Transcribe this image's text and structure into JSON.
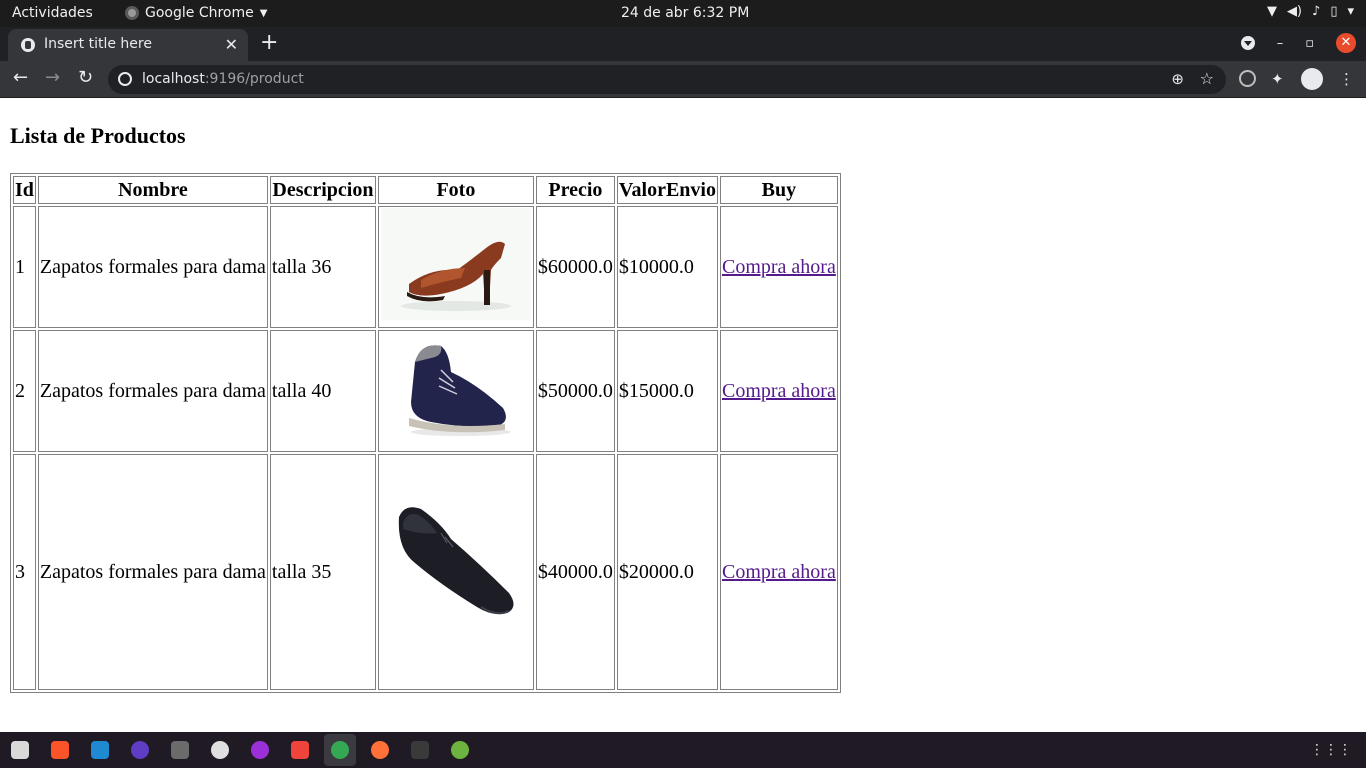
{
  "topbar": {
    "activities": "Actividades",
    "app_name": "Google Chrome",
    "clock": "24 de abr   6:32 PM"
  },
  "browser": {
    "tab_title": "Insert title here",
    "url_host": "localhost",
    "url_rest": ":9196/product"
  },
  "page": {
    "heading": "Lista de Productos",
    "columns": [
      "Id",
      "Nombre",
      "Descripcion",
      "Foto",
      "Precio",
      "ValorEnvio",
      "Buy"
    ],
    "rows": [
      {
        "id": "1",
        "nombre": "Zapatos formales para dama",
        "descripcion": "talla 36",
        "foto": "red-heel-sandal",
        "precio": "$60000.0",
        "envio": "$10000.0",
        "buy": "Compra ahora"
      },
      {
        "id": "2",
        "nombre": "Zapatos formales para dama",
        "descripcion": "talla 40",
        "foto": "navy-suede-boot",
        "precio": "$50000.0",
        "envio": "$15000.0",
        "buy": "Compra ahora"
      },
      {
        "id": "3",
        "nombre": "Zapatos formales para dama",
        "descripcion": "talla 35",
        "foto": "black-leather-boot",
        "precio": "$40000.0",
        "envio": "$20000.0",
        "buy": "Compra ahora"
      }
    ]
  },
  "taskbar": {
    "apps": [
      "files-icon",
      "brave-icon",
      "vscode-icon",
      "eclipse-icon",
      "inkscape-icon",
      "slack-icon",
      "firefox-dev-icon",
      "anydesk-icon",
      "chrome-icon",
      "firefox-icon",
      "terminal-icon",
      "spring-icon"
    ]
  }
}
